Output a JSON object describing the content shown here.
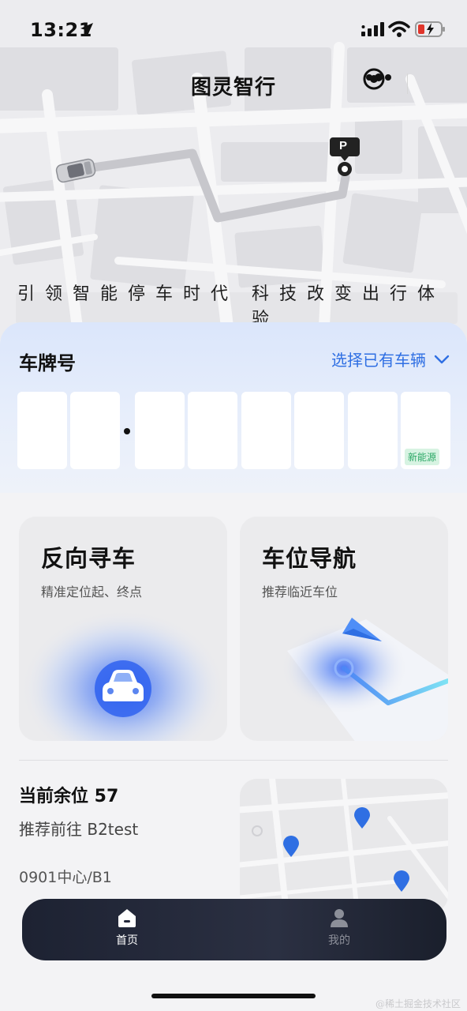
{
  "status_bar": {
    "time": "13:21",
    "icons": [
      "location-arrow-icon",
      "signal-icon",
      "wifi-icon",
      "battery-charging-icon"
    ]
  },
  "header": {
    "title": "图灵智行",
    "capsule_icons": [
      "more-dots-icon",
      "close-target-icon"
    ],
    "map_marker_label": "P",
    "slogan_left": "引领智能停车时代",
    "slogan_right": "科技改变出行体验"
  },
  "plate": {
    "label": "车牌号",
    "select_label": "选择已有车辆",
    "box_count": 8,
    "new_energy_tag": "新能源"
  },
  "features": [
    {
      "title": "反向寻车",
      "subtitle": "精准定位起、终点",
      "icon": "car-icon"
    },
    {
      "title": "车位导航",
      "subtitle": "推荐临近车位",
      "icon": "navigation-arrow-icon"
    }
  ],
  "parking": {
    "title": "当前余位 57",
    "recommend": "推荐前往 B2test",
    "location": "0901中心/B1"
  },
  "tabs": [
    {
      "label": "首页",
      "icon": "home-icon",
      "active": true
    },
    {
      "label": "我的",
      "icon": "user-icon",
      "active": false
    }
  ],
  "colors": {
    "accent": "#2f6fe3",
    "tab_bar": "#23283a",
    "tab_active": "#ffffff",
    "tab_inactive": "#8c8f99",
    "new_energy": "#2ca866"
  },
  "watermark": "@稀土掘金技术社区"
}
